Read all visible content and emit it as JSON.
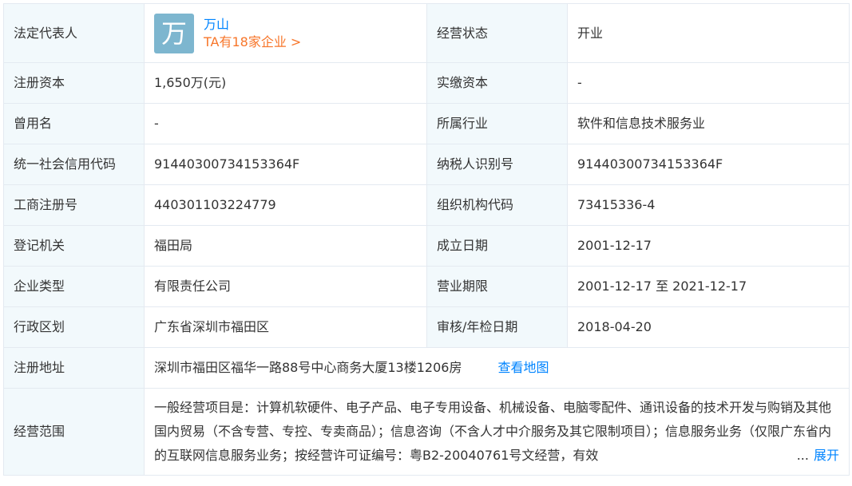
{
  "rows": {
    "legal_rep": {
      "label": "法定代表人",
      "avatar_char": "万",
      "name": "万山",
      "companies_link": "TA有18家企业 >",
      "status_label": "经营状态",
      "status_value": "开业"
    },
    "capital": {
      "label": "注册资本",
      "value": "1,650万(元)",
      "label2": "实缴资本",
      "value2": "-"
    },
    "former_name": {
      "label": "曾用名",
      "value": "-",
      "label2": "所属行业",
      "value2": "软件和信息技术服务业"
    },
    "credit_code": {
      "label": "统一社会信用代码",
      "value": "91440300734153364F",
      "label2": "纳税人识别号",
      "value2": "91440300734153364F"
    },
    "reg_no": {
      "label": "工商注册号",
      "value": "440301103224779",
      "label2": "组织机构代码",
      "value2": "73415336-4"
    },
    "authority": {
      "label": "登记机关",
      "value": "福田局",
      "label2": "成立日期",
      "value2": "2001-12-17"
    },
    "type": {
      "label": "企业类型",
      "value": "有限责任公司",
      "label2": "营业期限",
      "value2": "2001-12-17 至 2021-12-17"
    },
    "district": {
      "label": "行政区划",
      "value": "广东省深圳市福田区",
      "label2": "审核/年检日期",
      "value2": "2018-04-20"
    },
    "address": {
      "label": "注册地址",
      "value": "深圳市福田区福华一路88号中心商务大厦13楼1206房",
      "map_link": "查看地图"
    },
    "scope": {
      "label": "经营范围",
      "value": "一般经营项目是：计算机软硬件、电子产品、电子专用设备、机械设备、电脑零配件、通讯设备的技术开发与购销及其他国内贸易（不含专营、专控、专卖商品）；信息咨询（不含人才中介服务及其它限制项目）；信息服务业务（仅限广东省内的互联网信息服务业务；按经营许可证编号：粤B2-20040761号文经营，有效",
      "ellipsis": "...",
      "expand_link": "展开"
    }
  },
  "colors": {
    "label_bg": "#f2f9fc",
    "border": "#e4eaf1",
    "link_blue": "#0084ff",
    "link_orange": "#f7762a",
    "avatar_bg": "#7db6cf"
  }
}
